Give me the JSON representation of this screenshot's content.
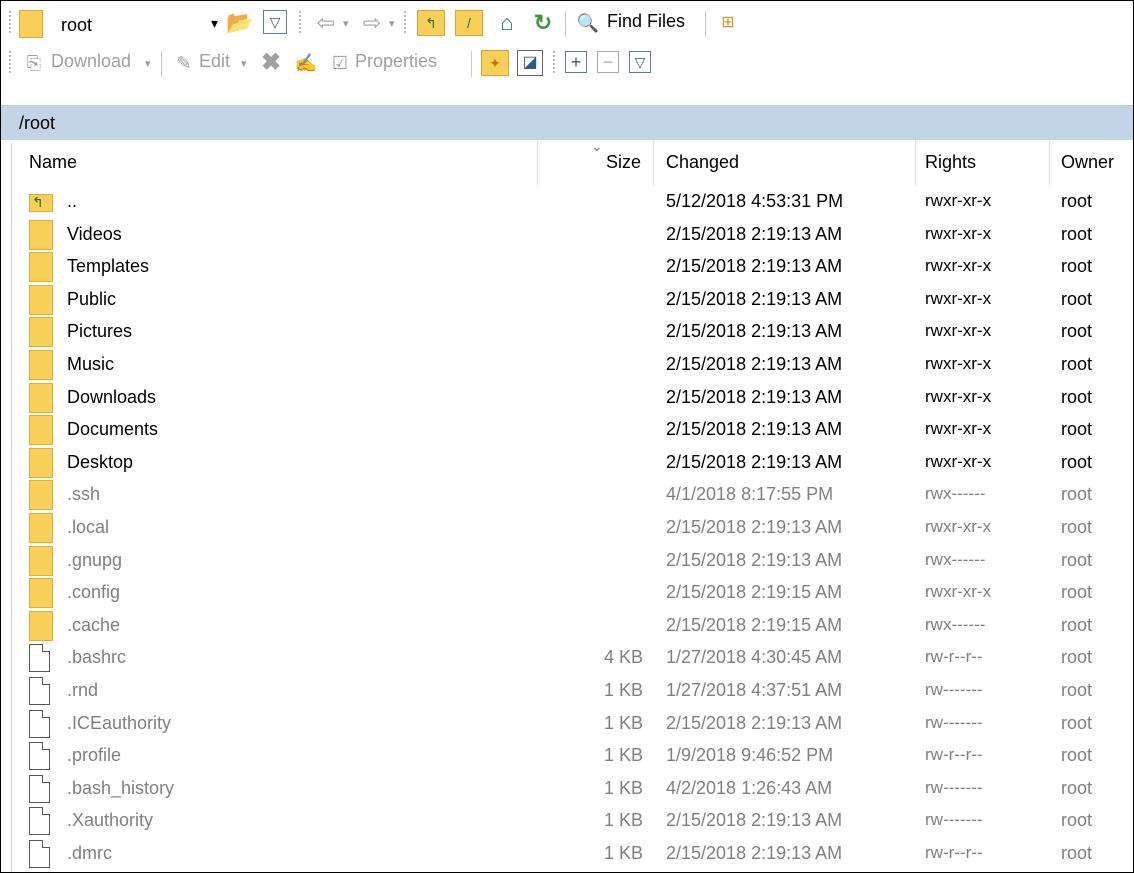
{
  "location_combo": {
    "value": "root"
  },
  "toolbar1": {
    "find_files_label": "Find Files",
    "icons": {
      "open_dir": "folder-open-icon",
      "filter": "filter-icon",
      "back": "arrow-left-icon",
      "forward": "arrow-right-icon",
      "parent": "parent-dir-icon",
      "root": "root-dir-icon",
      "home": "home-icon",
      "refresh": "refresh-icon",
      "find": "find-icon",
      "tree": "tree-icon"
    }
  },
  "toolbar2": {
    "download_label": "Download",
    "edit_label": "Edit",
    "properties_label": "Properties"
  },
  "path": "/root",
  "columns": {
    "name": "Name",
    "size": "Size",
    "changed": "Changed",
    "rights": "Rights",
    "owner": "Owner"
  },
  "files": [
    {
      "name": "..",
      "size": "",
      "changed": "5/12/2018 4:53:31 PM",
      "rights": "rwxr-xr-x",
      "owner": "root",
      "kind": "parent",
      "hidden": false
    },
    {
      "name": "Videos",
      "size": "",
      "changed": "2/15/2018 2:19:13 AM",
      "rights": "rwxr-xr-x",
      "owner": "root",
      "kind": "folder",
      "hidden": false
    },
    {
      "name": "Templates",
      "size": "",
      "changed": "2/15/2018 2:19:13 AM",
      "rights": "rwxr-xr-x",
      "owner": "root",
      "kind": "folder",
      "hidden": false
    },
    {
      "name": "Public",
      "size": "",
      "changed": "2/15/2018 2:19:13 AM",
      "rights": "rwxr-xr-x",
      "owner": "root",
      "kind": "folder",
      "hidden": false
    },
    {
      "name": "Pictures",
      "size": "",
      "changed": "2/15/2018 2:19:13 AM",
      "rights": "rwxr-xr-x",
      "owner": "root",
      "kind": "folder",
      "hidden": false
    },
    {
      "name": "Music",
      "size": "",
      "changed": "2/15/2018 2:19:13 AM",
      "rights": "rwxr-xr-x",
      "owner": "root",
      "kind": "folder",
      "hidden": false
    },
    {
      "name": "Downloads",
      "size": "",
      "changed": "2/15/2018 2:19:13 AM",
      "rights": "rwxr-xr-x",
      "owner": "root",
      "kind": "folder",
      "hidden": false
    },
    {
      "name": "Documents",
      "size": "",
      "changed": "2/15/2018 2:19:13 AM",
      "rights": "rwxr-xr-x",
      "owner": "root",
      "kind": "folder",
      "hidden": false
    },
    {
      "name": "Desktop",
      "size": "",
      "changed": "2/15/2018 2:19:13 AM",
      "rights": "rwxr-xr-x",
      "owner": "root",
      "kind": "folder",
      "hidden": false
    },
    {
      "name": ".ssh",
      "size": "",
      "changed": "4/1/2018 8:17:55 PM",
      "rights": "rwx------",
      "owner": "root",
      "kind": "folder",
      "hidden": true
    },
    {
      "name": ".local",
      "size": "",
      "changed": "2/15/2018 2:19:13 AM",
      "rights": "rwxr-xr-x",
      "owner": "root",
      "kind": "folder",
      "hidden": true
    },
    {
      "name": ".gnupg",
      "size": "",
      "changed": "2/15/2018 2:19:13 AM",
      "rights": "rwx------",
      "owner": "root",
      "kind": "folder",
      "hidden": true
    },
    {
      "name": ".config",
      "size": "",
      "changed": "2/15/2018 2:19:15 AM",
      "rights": "rwxr-xr-x",
      "owner": "root",
      "kind": "folder",
      "hidden": true
    },
    {
      "name": ".cache",
      "size": "",
      "changed": "2/15/2018 2:19:15 AM",
      "rights": "rwx------",
      "owner": "root",
      "kind": "folder",
      "hidden": true
    },
    {
      "name": ".bashrc",
      "size": "4 KB",
      "changed": "1/27/2018 4:30:45 AM",
      "rights": "rw-r--r--",
      "owner": "root",
      "kind": "file",
      "hidden": true
    },
    {
      "name": ".rnd",
      "size": "1 KB",
      "changed": "1/27/2018 4:37:51 AM",
      "rights": "rw-------",
      "owner": "root",
      "kind": "file",
      "hidden": true
    },
    {
      "name": ".ICEauthority",
      "size": "1 KB",
      "changed": "2/15/2018 2:19:13 AM",
      "rights": "rw-------",
      "owner": "root",
      "kind": "file",
      "hidden": true
    },
    {
      "name": ".profile",
      "size": "1 KB",
      "changed": "1/9/2018 9:46:52 PM",
      "rights": "rw-r--r--",
      "owner": "root",
      "kind": "file",
      "hidden": true
    },
    {
      "name": ".bash_history",
      "size": "1 KB",
      "changed": "4/2/2018 1:26:43 AM",
      "rights": "rw-------",
      "owner": "root",
      "kind": "file",
      "hidden": true
    },
    {
      "name": ".Xauthority",
      "size": "1 KB",
      "changed": "2/15/2018 2:19:13 AM",
      "rights": "rw-------",
      "owner": "root",
      "kind": "file",
      "hidden": true
    },
    {
      "name": ".dmrc",
      "size": "1 KB",
      "changed": "2/15/2018 2:19:13 AM",
      "rights": "rw-r--r--",
      "owner": "root",
      "kind": "file",
      "hidden": true
    }
  ]
}
